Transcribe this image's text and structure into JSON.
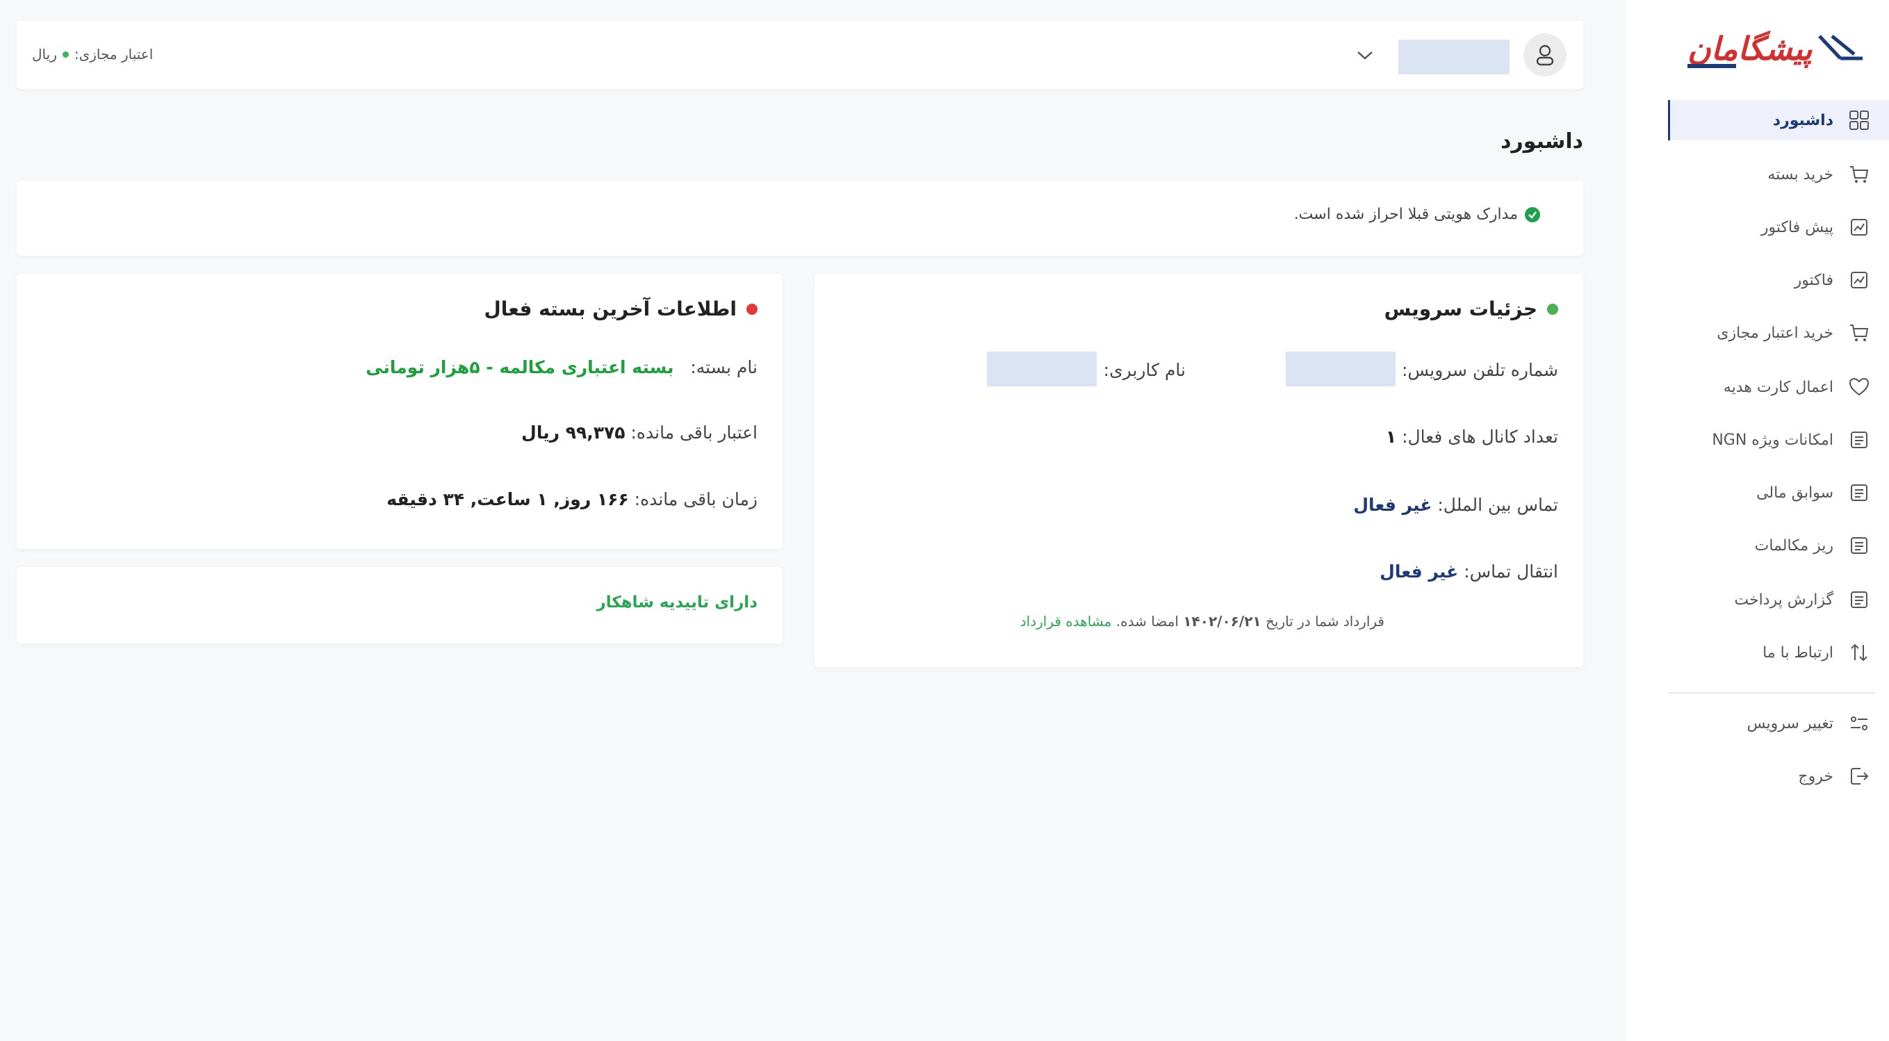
{
  "header": {
    "credit_label": "اعتبار مجازی:",
    "credit_unit": "ریال",
    "icons": {
      "avatar": "user-icon",
      "menu": "chevron-down-icon"
    }
  },
  "page": {
    "title": "داشبورد"
  },
  "notice": {
    "text": "مدارک هویتی قبلا احراز شده است.",
    "icon": "check-circle-icon"
  },
  "service": {
    "title": "جزئیات سرویس",
    "status_color": "#4caf50",
    "phone_label": "شماره تلفن سرویس:",
    "username_label": "نام کاربری:",
    "channels_label": "تعداد کانال های فعال:",
    "channels_value": "۱",
    "international_label": "تماس بین الملل:",
    "international_value": "غیر فعال",
    "transfer_label": "انتقال تماس:",
    "transfer_value": "غیر فعال",
    "contract_prefix": "قرارداد شما در تاریخ",
    "contract_date": "۱۴۰۲/۰۶/۲۱",
    "contract_suffix": "امضا شده.",
    "contract_link": "مشاهده قرارداد"
  },
  "package": {
    "title": "اطلاعات آخرین بسته فعال",
    "status_color": "#e53935",
    "name_label": "نام بسته:",
    "name_value": "بسته اعتباری مکالمه - ۵هزار تومانی",
    "credit_label": "اعتبار باقی مانده:",
    "credit_value": "۹۹,۳۷۵ ریال",
    "time_label": "زمان باقی مانده:",
    "time_value": "۱۶۶ روز, ۱ ساعت, ۳۴ دقیقه"
  },
  "approval": {
    "text": "دارای تاییدیه شاهکار"
  },
  "brand": {
    "logo_text": "پیشگامان",
    "logo_color": "#d32f2f"
  },
  "sidebar": {
    "items": [
      {
        "label": "داشبورد",
        "icon": "grid-icon"
      },
      {
        "label": "خرید بسته",
        "icon": "cart-icon"
      },
      {
        "label": "پیش فاکتور",
        "icon": "chart-doc-icon"
      },
      {
        "label": "فاکتور",
        "icon": "chart-doc-icon"
      },
      {
        "label": "خرید اعتبار مجازی",
        "icon": "cart-icon"
      },
      {
        "label": "اعمال کارت هدیه",
        "icon": "heart-icon"
      },
      {
        "label": "امکانات ویژه NGN",
        "icon": "document-icon"
      },
      {
        "label": "سوابق مالی",
        "icon": "document-icon"
      },
      {
        "label": "ریز مکالمات",
        "icon": "document-icon"
      },
      {
        "label": "گزارش پرداخت",
        "icon": "document-icon"
      },
      {
        "label": "ارتباط با ما",
        "icon": "arrows-updown-icon"
      },
      {
        "label": "تغییر سرویس",
        "icon": "switch-icon"
      },
      {
        "label": "خروج",
        "icon": "logout-icon"
      }
    ]
  }
}
